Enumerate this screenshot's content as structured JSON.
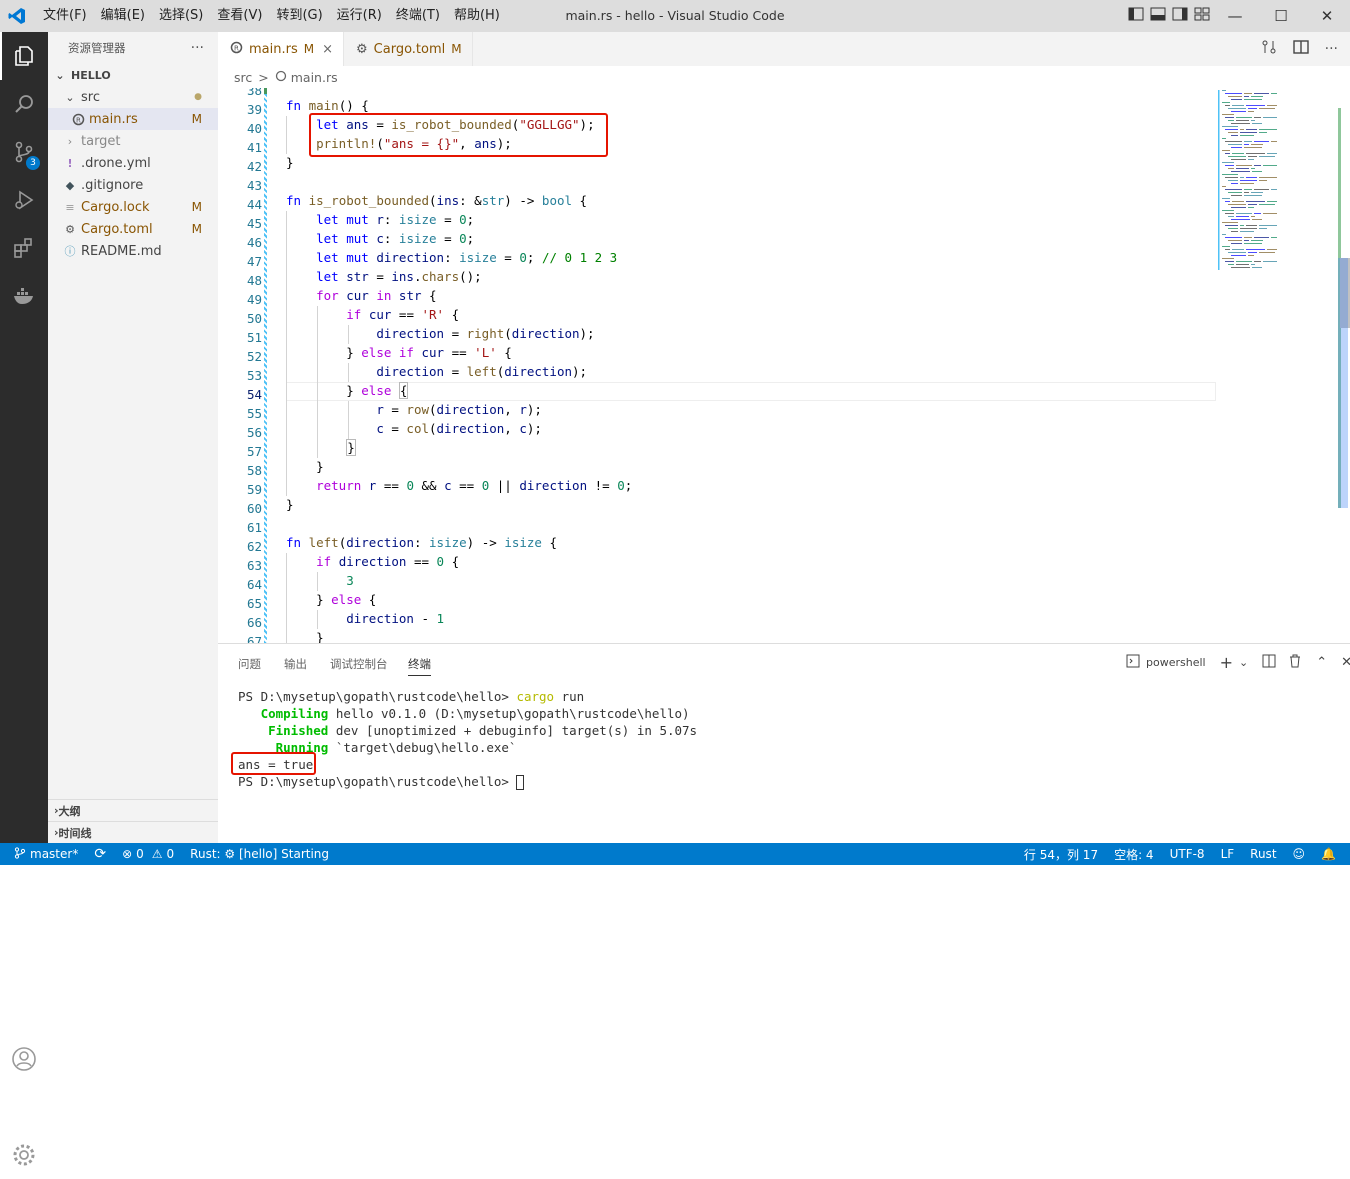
{
  "window": {
    "title": "main.rs - hello - Visual Studio Code"
  },
  "menu": [
    "文件(F)",
    "编辑(E)",
    "选择(S)",
    "查看(V)",
    "转到(G)",
    "运行(R)",
    "终端(T)",
    "帮助(H)"
  ],
  "window_controls": {
    "minimize": "—",
    "restore": "☐",
    "close": "✕"
  },
  "activity_bar": {
    "scm_badge": "3"
  },
  "sidebar": {
    "title": "资源管理器",
    "more": "···",
    "folder": "HELLO",
    "items": [
      {
        "label": "src",
        "kind": "folder-open",
        "mod": "●"
      },
      {
        "label": "main.rs",
        "kind": "rust",
        "mod": "M"
      },
      {
        "label": "target",
        "kind": "folder-closed",
        "mod": ""
      },
      {
        "label": ".drone.yml",
        "kind": "yaml",
        "mod": ""
      },
      {
        "label": ".gitignore",
        "kind": "git",
        "mod": ""
      },
      {
        "label": "Cargo.lock",
        "kind": "lock",
        "mod": "M"
      },
      {
        "label": "Cargo.toml",
        "kind": "gear",
        "mod": "M"
      },
      {
        "label": "README.md",
        "kind": "info",
        "mod": ""
      }
    ],
    "outline": "大纲",
    "timeline": "时间线"
  },
  "tabs": [
    {
      "label": "main.rs",
      "mod": "M",
      "close": "×"
    },
    {
      "label": "Cargo.toml",
      "mod": "M"
    }
  ],
  "breadcrumb": {
    "folder": "src",
    "sep": ">",
    "file": "main.rs"
  },
  "editor": {
    "line_numbers": [
      "38",
      "39",
      "40",
      "41",
      "42",
      "43",
      "44",
      "45",
      "46",
      "47",
      "48",
      "49",
      "50",
      "51",
      "52",
      "53",
      "54",
      "55",
      "56",
      "57",
      "58",
      "59",
      "60",
      "61",
      "62",
      "63",
      "64",
      "65",
      "66",
      "67"
    ],
    "current_line": "54"
  },
  "panel": {
    "tabs": [
      "问题",
      "输出",
      "调试控制台",
      "终端"
    ],
    "active_tab": "终端",
    "shell": "powershell",
    "lines": {
      "prompt1": "PS D:\\mysetup\\gopath\\rustcode\\hello> ",
      "cmd1": "cargo",
      "cmd2": " run",
      "compiling_label": "   Compiling",
      "compiling_rest": " hello v0.1.0 (D:\\mysetup\\gopath\\rustcode\\hello)",
      "finished_label": "    Finished",
      "finished_rest": " dev [unoptimized + debuginfo] target(s) in 5.07s",
      "running_label": "     Running",
      "running_rest": " `target\\debug\\hello.exe`",
      "output": "ans = true",
      "prompt2": "PS D:\\mysetup\\gopath\\rustcode\\hello> "
    }
  },
  "statusbar": {
    "branch": "master*",
    "errors": "0",
    "warnings": "0",
    "rust_status": "Rust: ⚙ [hello] Starting",
    "position": "行 54，列 17",
    "spaces": "空格: 4",
    "encoding": "UTF-8",
    "eol": "LF",
    "language": "Rust"
  },
  "colors": {
    "accent": "#007acc",
    "highlight_box": "#e51400",
    "modified": "#895503"
  }
}
